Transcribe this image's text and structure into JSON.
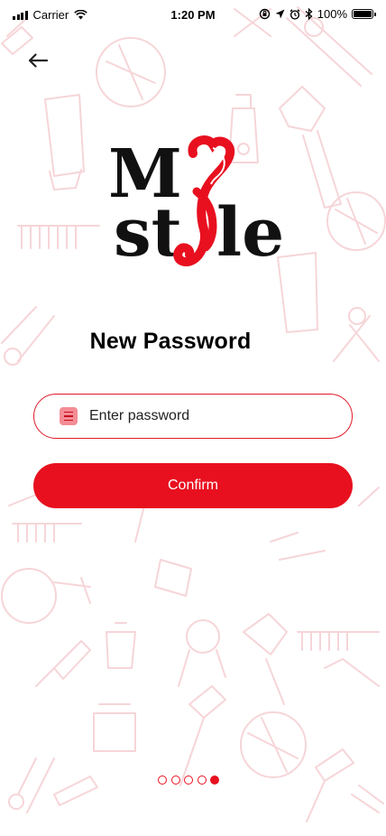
{
  "status_bar": {
    "carrier": "Carrier",
    "time": "1:20 PM",
    "battery": "100%"
  },
  "brand": {
    "logo_text": "My Style",
    "accent_color": "#e8101f"
  },
  "screen": {
    "title": "New Password"
  },
  "password_field": {
    "placeholder": "Enter password",
    "value": ""
  },
  "confirm_button": {
    "label": "Confirm"
  },
  "pagination": {
    "total": 5,
    "current": 5
  },
  "icons": {
    "back": "arrow-left-icon",
    "field": "lock-icon"
  }
}
